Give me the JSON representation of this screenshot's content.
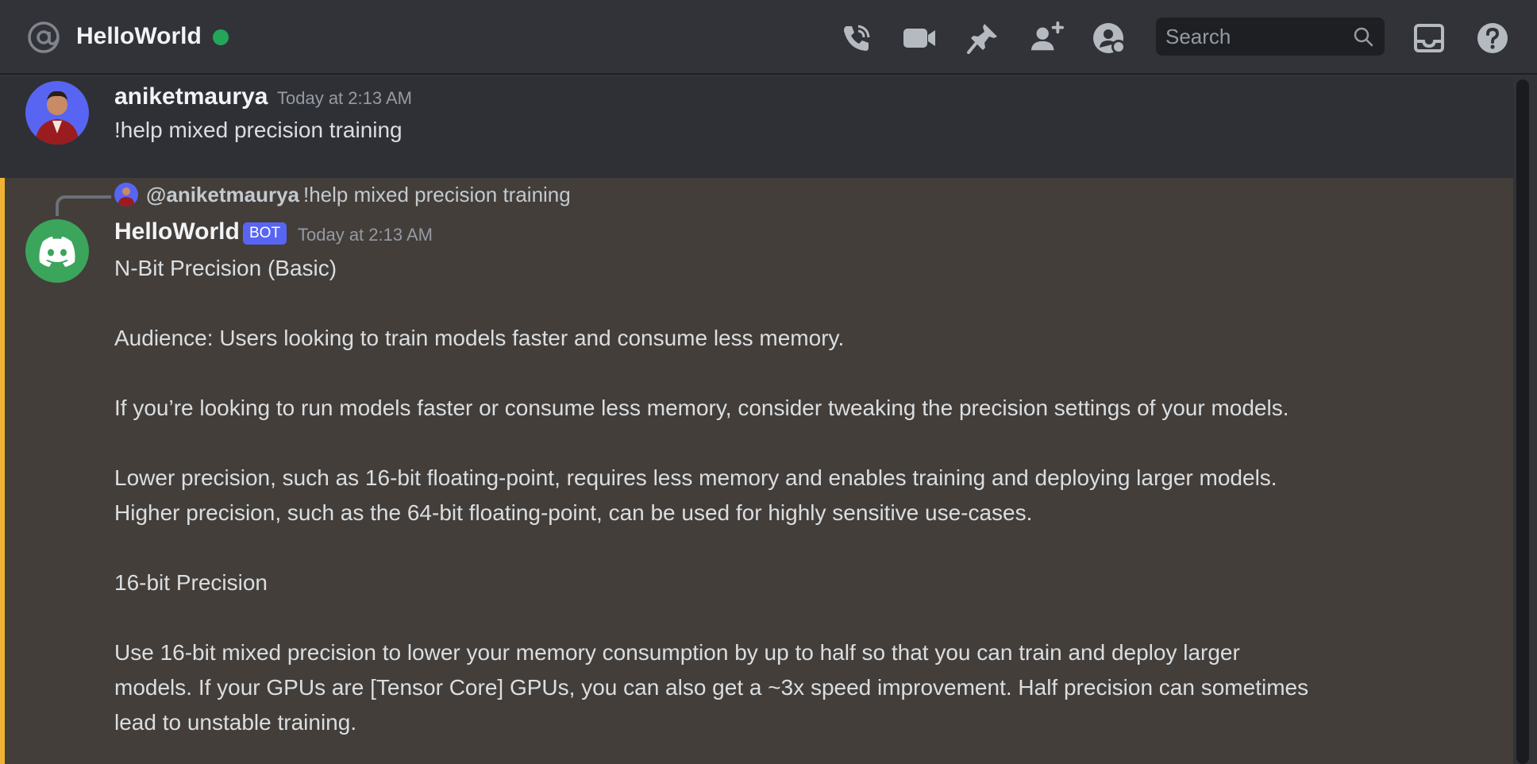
{
  "header": {
    "channel_name": "HelloWorld",
    "status": "online",
    "search": {
      "placeholder": "Search"
    },
    "icons": [
      "at-icon",
      "call-icon",
      "video-icon",
      "pin-icon",
      "add-member-icon",
      "user-profile-icon",
      "inbox-icon",
      "help-icon"
    ],
    "accent_online": "#23a55a"
  },
  "messages": [
    {
      "author": "aniketmaurya",
      "timestamp": "Today at 2:13 AM",
      "text": "!help mixed precision training"
    },
    {
      "reply": {
        "author": "@aniketmaurya",
        "text": "!help mixed precision training"
      },
      "author": "HelloWorld",
      "badge": "BOT",
      "timestamp": "Today at 2:13 AM",
      "lines": [
        "N-Bit Precision (Basic)",
        "",
        "Audience: Users looking to train models faster and consume less memory.",
        "",
        "If you’re looking to run models faster or consume less memory, consider tweaking the precision settings of your models.",
        "",
        "Lower precision, such as 16-bit floating-point, requires less memory and enables training and deploying larger models.",
        "Higher precision, such as the 64-bit floating-point, can be used for highly sensitive use-cases.",
        "",
        "16-bit Precision",
        "",
        "Use 16-bit mixed precision to lower your memory consumption by up to half so that you can train and deploy larger",
        "models. If your GPUs are [Tensor Core] GPUs, you can also get a ~3x speed improvement. Half precision can sometimes",
        "lead to unstable training."
      ],
      "mention_highlight_color": "#f0b232",
      "badge_color": "#5865f2"
    }
  ]
}
